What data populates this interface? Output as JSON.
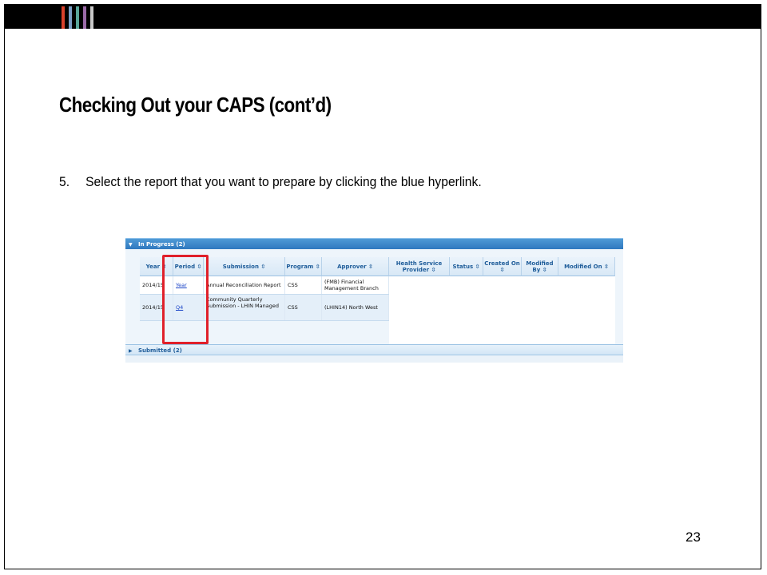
{
  "slide": {
    "title": "Checking Out your CAPS (cont’d)",
    "step_number": "5.",
    "step_text": "Select the report that you want to prepare by clicking the blue hyperlink.",
    "page_number": "23",
    "stripe_colors": [
      "#d9412b",
      "#7b9fc6",
      "#5aa69a",
      "#9b6aa8",
      "#c9c9c9"
    ]
  },
  "screenshot": {
    "in_progress_label": "In Progress (2)",
    "submitted_label": "Submitted (2)",
    "columns": [
      {
        "label": "Year ⇳"
      },
      {
        "label": "Period ⇳"
      },
      {
        "label": "Submission ⇳"
      },
      {
        "label": "Program ⇳"
      },
      {
        "label": "Approver ⇳"
      },
      {
        "label": "Health Service Provider ⇳"
      },
      {
        "label": "Status ⇳"
      },
      {
        "label": "Created On ⇳"
      },
      {
        "label": "Modified By ⇳"
      },
      {
        "label": "Modified On ⇳"
      }
    ],
    "rows": [
      {
        "year": "2014/15",
        "period": "Year",
        "submission": "Annual Reconciliation Report",
        "program": "CSS",
        "approver": "(FMB) Financial Management Branch"
      },
      {
        "year": "2014/15",
        "period": "Q4",
        "submission": "Community Quarterly Submission - LHIN Managed",
        "program": "CSS",
        "approver": "(LHIN14) North West"
      }
    ],
    "highlight_color": "#e0202a"
  }
}
